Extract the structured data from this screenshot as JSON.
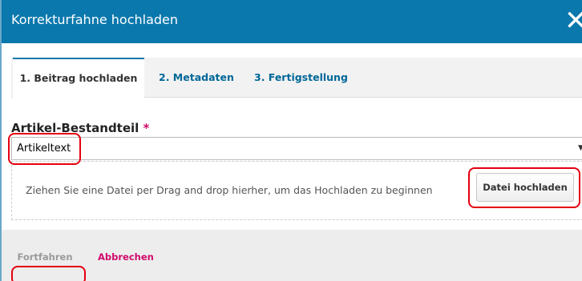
{
  "dialog": {
    "title": "Korrekturfahne hochladen",
    "close_symbol": "✕"
  },
  "tabs": [
    {
      "label": "1. Beitrag hochladen",
      "active": true
    },
    {
      "label": "2. Metadaten",
      "active": false
    },
    {
      "label": "3. Fertigstellung",
      "active": false
    }
  ],
  "form": {
    "field_label": "Artikel-Bestandteil",
    "required_marker": "*",
    "select_value": "Artikeltext",
    "select_arrow": "▼"
  },
  "dropzone": {
    "text": "Ziehen Sie eine Datei per Drag and drop hierher, um das Hochladen zu beginnen",
    "upload_label": "Datei hochladen"
  },
  "footer": {
    "continue_label": "Fortfahren",
    "cancel_label": "Abbrechen"
  },
  "colors": {
    "header_bg": "#0a78ad",
    "accent_link": "#006798",
    "cancel": "#d00a6c",
    "highlight": "#e4000f"
  }
}
